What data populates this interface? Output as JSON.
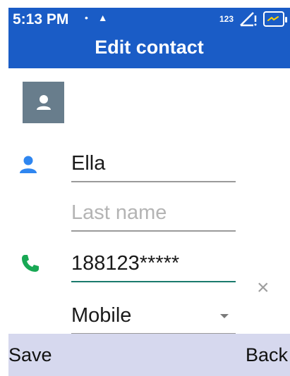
{
  "status_bar": {
    "time": "5:13 PM",
    "network_label": "123",
    "icons": [
      "usb-icon",
      "notification-icon",
      "signal-icon",
      "battery-charging-icon"
    ]
  },
  "header": {
    "title": "Edit contact"
  },
  "form": {
    "first_name": {
      "value": "Ella"
    },
    "last_name": {
      "placeholder": "Last name",
      "value": ""
    },
    "phone": {
      "value": "188123*****"
    },
    "phone_type": {
      "selected": "Mobile"
    }
  },
  "softkeys": {
    "left": "Save",
    "right": "Back"
  },
  "colors": {
    "appbar": "#1a5cc6",
    "person_icon": "#2f86f0",
    "phone_icon": "#18a854",
    "avatar_bg": "#687d8c",
    "softkey_bar": "#d6d8ee",
    "active_underline": "#1a7a6c"
  }
}
